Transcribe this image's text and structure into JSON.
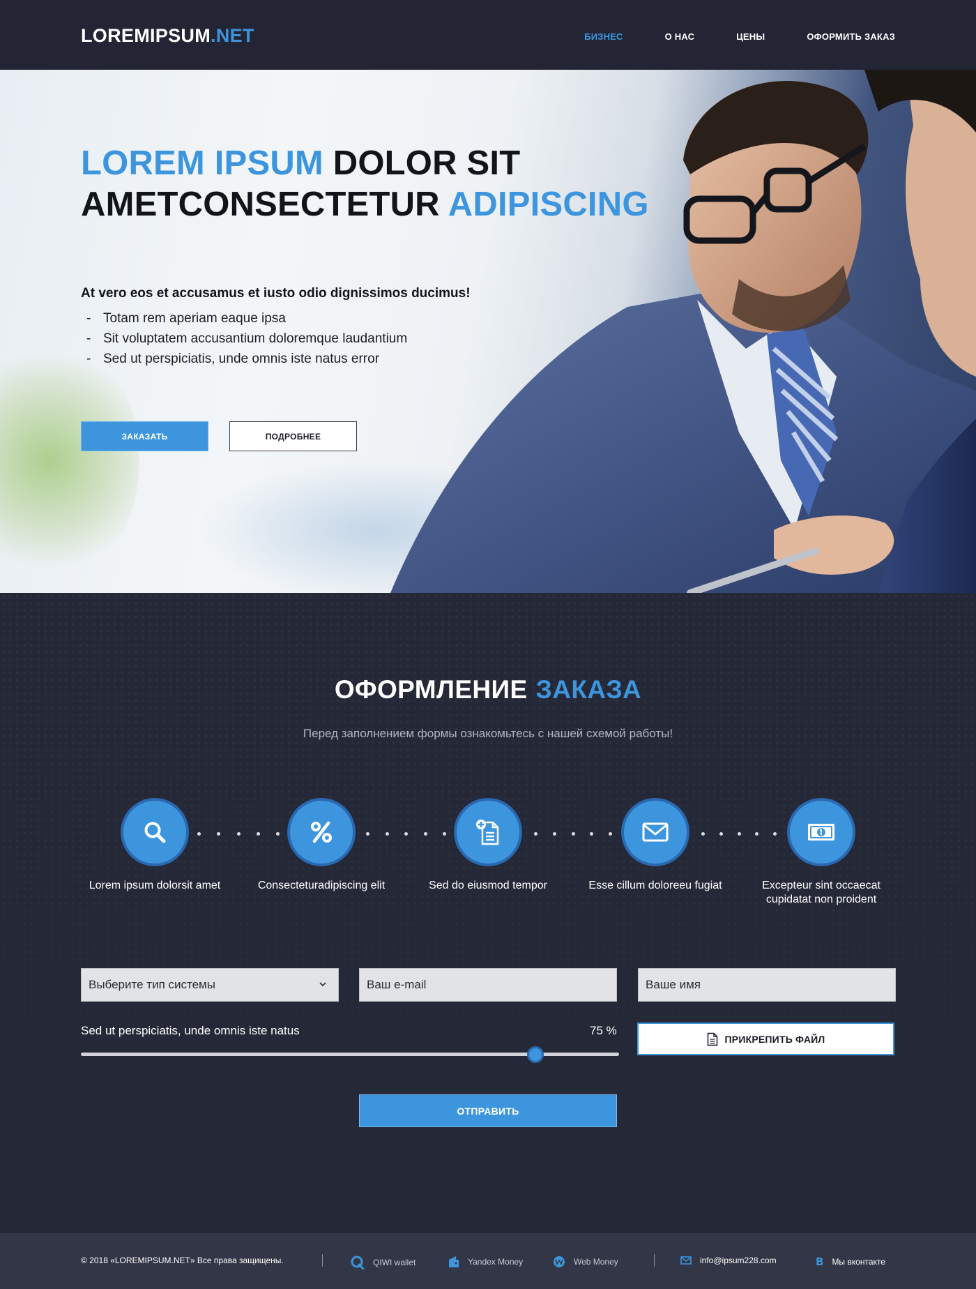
{
  "header": {
    "logo_main": "LOREMIPSUM",
    "logo_accent": ".NET",
    "nav": [
      {
        "label": "БИЗНЕС",
        "active": true
      },
      {
        "label": "О НАС",
        "active": false
      },
      {
        "label": "ЦЕНЫ",
        "active": false
      },
      {
        "label": "ОФОРМИТЬ ЗАКАЗ",
        "active": false
      }
    ]
  },
  "hero": {
    "title_line1_blue": "LOREM IPSUM",
    "title_line1_dark": "DOLOR SIT",
    "title_line2_dark": "AMETCONSECTETUR",
    "title_line2_blue": "ADIPISCING",
    "lead": "At vero eos et accusamus et iusto odio dignissimos ducimus!",
    "bullets": [
      "Totam rem aperiam eaque ipsa",
      "Sit voluptatem accusantium doloremque laudantium",
      "Sed ut perspiciatis, unde omnis iste natus error"
    ],
    "btn_order": "ЗАКАЗАТЬ",
    "btn_more": "ПОДРОБНЕЕ"
  },
  "order": {
    "title_white": "ОФОРМЛЕНИЕ",
    "title_blue": "ЗАКАЗА",
    "subtitle": "Перед заполнением формы ознакомьтесь с нашей схемой работы!",
    "steps": [
      {
        "label": "Lorem ipsum dolorsit amet",
        "icon": "search-icon"
      },
      {
        "label": "Consecteturadipiscing elit",
        "icon": "percent-icon"
      },
      {
        "label": "Sed do eiusmod tempor",
        "icon": "document-add-icon"
      },
      {
        "label": "Esse cillum doloreeu fugiat",
        "icon": "envelope-icon"
      },
      {
        "label": "Excepteur sint occaecat cupidatat non proident",
        "icon": "banknote-icon"
      }
    ],
    "system_select": "Выберите тип системы",
    "email_placeholder": "Ваш e-mail",
    "name_placeholder": "Ваше имя",
    "slider_label": "Sed ut perspiciatis, unde omnis iste natus",
    "slider_value_text": "75 %",
    "slider_value": 0.75,
    "attach_label": "ПРИКРЕПИТЬ ФАЙЛ",
    "submit_label": "ОТПРАВИТЬ"
  },
  "footer": {
    "copyright": "© 2018 «LOREMIPSUM.NET» Все права защищены.",
    "payments": [
      {
        "label": "QIWI wallet",
        "icon": "qiwi-icon"
      },
      {
        "label": "Yandex Money",
        "icon": "yandex-money-icon"
      },
      {
        "label": "Web Money",
        "icon": "webmoney-icon"
      }
    ],
    "email": "info@ipsum228.com",
    "vk": "Мы вконтакте"
  },
  "colors": {
    "accent": "#3d96dd",
    "dark_bg": "#252837",
    "header_bg": "#232535",
    "footer_bg": "#333646"
  }
}
